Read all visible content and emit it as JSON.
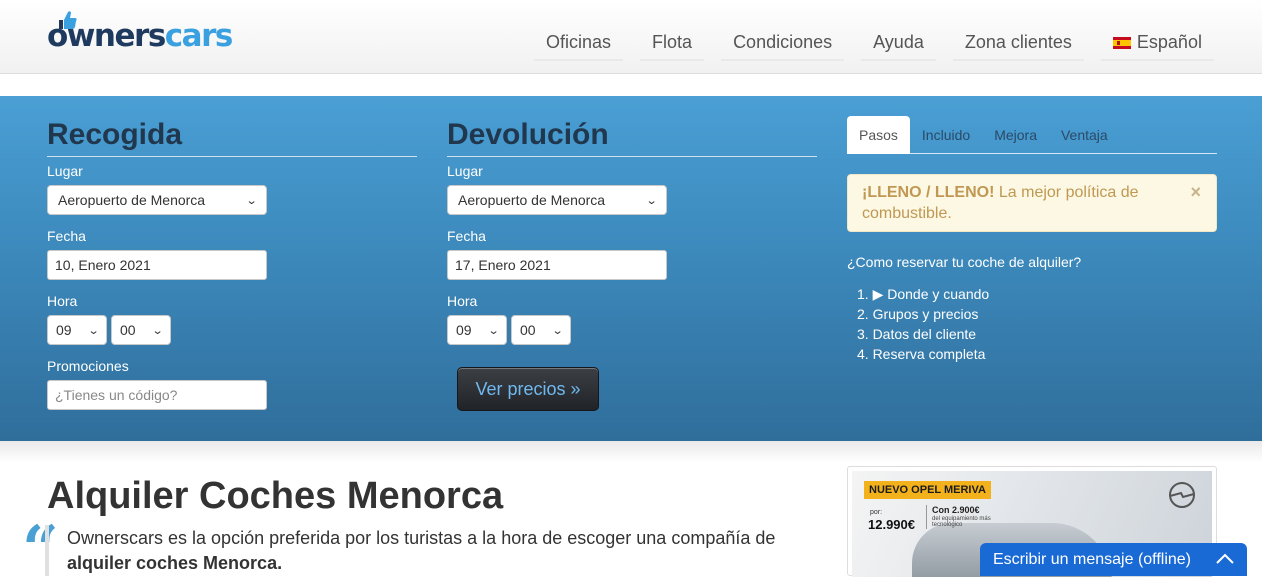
{
  "brand": {
    "logo_owners": "owners",
    "logo_cars": "cars"
  },
  "nav": {
    "items": [
      "Oficinas",
      "Flota",
      "Condiciones",
      "Ayuda",
      "Zona clientes"
    ],
    "language": "Español",
    "language_flag": "spain-flag-icon"
  },
  "pickup": {
    "title": "Recogida",
    "place_label": "Lugar",
    "place_value": "Aeropuerto de Menorca",
    "date_label": "Fecha",
    "date_value": "10, Enero 2021",
    "time_label": "Hora",
    "hour_value": "09",
    "minute_value": "00",
    "promo_label": "Promociones",
    "promo_placeholder": "¿Tienes un código?"
  },
  "return": {
    "title": "Devolución",
    "place_label": "Lugar",
    "place_value": "Aeropuerto de Menorca",
    "date_label": "Fecha",
    "date_value": "17, Enero 2021",
    "time_label": "Hora",
    "hour_value": "09",
    "minute_value": "00",
    "search_button": "Ver precios »"
  },
  "info": {
    "tabs": [
      "Pasos",
      "Incluido",
      "Mejora",
      "Ventaja"
    ],
    "active_tab": "Pasos",
    "alert_bold": "¡LLENO / LLENO!",
    "alert_text": " La mejor política de combustible.",
    "alert_close": "×",
    "howto_title": "¿Como reservar tu coche de alquiler?",
    "steps": [
      "1.  ▶ Donde y cuando",
      "2. Grupos y precios",
      "3. Datos del cliente",
      "4. Reserva completa"
    ]
  },
  "content": {
    "heading": "Alquiler Coches Menorca",
    "quote_mark": "“",
    "quote_text": "Ownerscars es la opción preferida por los turistas a la hora de escoger una compañía de ",
    "quote_bold": "alquiler coches Menorca."
  },
  "promo": {
    "tag": "NUEVO OPEL MERIVA",
    "por": "por:",
    "price": "12.990€",
    "save": "Con 2.900€",
    "save_small": "del equipamiento más tecnológico"
  },
  "chat": {
    "label": "Escribir un mensaje (offline)"
  },
  "colors": {
    "band_top": "#4a9fd4",
    "band_bottom": "#2f6e9b",
    "heading_dark": "#21374d",
    "alert_bg": "#fcf8e3",
    "alert_text": "#c09853",
    "chat_blue": "#1a6ad6"
  }
}
